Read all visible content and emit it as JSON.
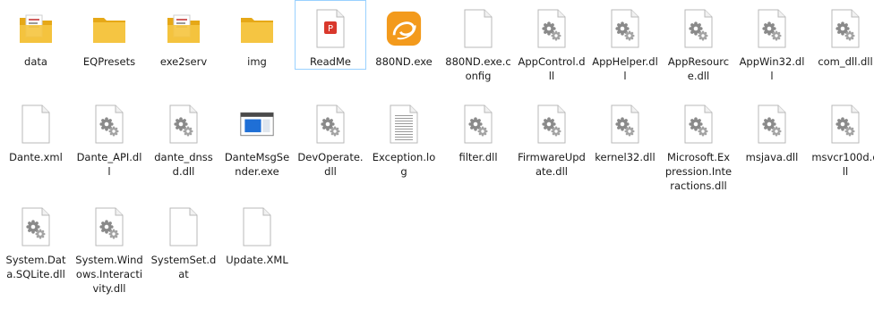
{
  "window": {
    "items": [
      {
        "label": "data",
        "icon": "folder-documents-icon",
        "type": "folder"
      },
      {
        "label": "EQPresets",
        "icon": "folder-icon",
        "type": "folder"
      },
      {
        "label": "exe2serv",
        "icon": "folder-documents-icon",
        "type": "folder"
      },
      {
        "label": "img",
        "icon": "folder-icon",
        "type": "folder"
      },
      {
        "label": "ReadMe",
        "icon": "pdf-file-icon",
        "type": "pdf",
        "selected": true
      },
      {
        "label": "880ND.exe",
        "icon": "app-swirl-icon",
        "type": "app"
      },
      {
        "label": "880ND.exe.config",
        "icon": "blank-file-icon",
        "type": "blank"
      },
      {
        "label": "AppControl.dll",
        "icon": "dll-gear-icon",
        "type": "dll"
      },
      {
        "label": "AppHelper.dll",
        "icon": "dll-gear-icon",
        "type": "dll"
      },
      {
        "label": "AppResource.dll",
        "icon": "dll-gear-icon",
        "type": "dll"
      },
      {
        "label": "AppWin32.dll",
        "icon": "dll-gear-icon",
        "type": "dll"
      },
      {
        "label": "com_dll.dll",
        "icon": "dll-gear-icon",
        "type": "dll"
      },
      {
        "label": "Dante.xml",
        "icon": "blank-file-icon",
        "type": "blank"
      },
      {
        "label": "Dante_API.dll",
        "icon": "dll-gear-icon",
        "type": "dll"
      },
      {
        "label": "dante_dnssd.dll",
        "icon": "dll-gear-icon",
        "type": "dll"
      },
      {
        "label": "DanteMsgSender.exe",
        "icon": "exe-window-icon",
        "type": "exe"
      },
      {
        "label": "DevOperate.dll",
        "icon": "dll-gear-icon",
        "type": "dll"
      },
      {
        "label": "Exception.log",
        "icon": "text-file-icon",
        "type": "text"
      },
      {
        "label": "filter.dll",
        "icon": "dll-gear-icon",
        "type": "dll"
      },
      {
        "label": "FirmwareUpdate.dll",
        "icon": "dll-gear-icon",
        "type": "dll"
      },
      {
        "label": "kernel32.dll",
        "icon": "dll-gear-icon",
        "type": "dll"
      },
      {
        "label": "Microsoft.Expression.Interactions.dll",
        "icon": "dll-gear-icon",
        "type": "dll"
      },
      {
        "label": "msjava.dll",
        "icon": "dll-gear-icon",
        "type": "dll"
      },
      {
        "label": "msvcr100d.dll",
        "icon": "dll-gear-icon",
        "type": "dll"
      },
      {
        "label": "System.Data.SQLite.dll",
        "icon": "dll-gear-icon",
        "type": "dll"
      },
      {
        "label": "System.Windows.Interactivity.dll",
        "icon": "dll-gear-icon",
        "type": "dll"
      },
      {
        "label": "SystemSet.dat",
        "icon": "blank-file-icon",
        "type": "blank"
      },
      {
        "label": "Update.XML",
        "icon": "blank-file-icon",
        "type": "blank"
      }
    ]
  },
  "colors": {
    "folder": "#f5c542",
    "folder_dark": "#e6a817",
    "selection_border": "#99d1ff",
    "pdf_red": "#d9382c",
    "swirl_orange": "#f39a1c"
  }
}
